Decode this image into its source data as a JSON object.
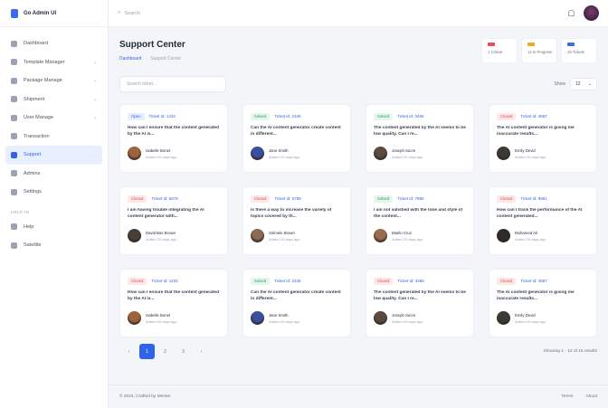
{
  "brand": {
    "name": "Go Admin UI"
  },
  "sidebar": {
    "items": [
      {
        "label": "Dashboard",
        "icon": "home-icon",
        "chevron": false
      },
      {
        "label": "Template Manager",
        "icon": "template-icon",
        "chevron": true
      },
      {
        "label": "Package Manage",
        "icon": "package-icon",
        "chevron": true
      },
      {
        "label": "Shipment",
        "icon": "shipment-icon",
        "chevron": true
      },
      {
        "label": "User Manage",
        "icon": "user-icon",
        "chevron": true
      },
      {
        "label": "Transaction",
        "icon": "transaction-icon",
        "chevron": false
      },
      {
        "label": "Support",
        "icon": "support-icon",
        "chevron": false,
        "active": true
      },
      {
        "label": "Admins",
        "icon": "admin-icon",
        "chevron": false
      },
      {
        "label": "Settings",
        "icon": "gear-icon",
        "chevron": false
      }
    ],
    "section_label": "HELP IN",
    "help_items": [
      {
        "label": "Help",
        "icon": "help-icon"
      },
      {
        "label": "Satellite",
        "icon": "satellite-icon"
      }
    ]
  },
  "topbar": {
    "search_placeholder": "Search"
  },
  "page": {
    "title": "Support Center",
    "breadcrumb": {
      "link": "Dashboard",
      "separator": "·",
      "current": "Support Center"
    }
  },
  "stats": [
    {
      "label": "1 Critical",
      "color": "#ef4b5a"
    },
    {
      "label": "12 In Progress",
      "color": "#f5a524"
    },
    {
      "label": "16 Tickets",
      "color": "#3b6cf0"
    }
  ],
  "filters": {
    "search_placeholder": "Search ticket...",
    "show_label": "Show",
    "show_value": "12"
  },
  "tickets": [
    {
      "status": "Open",
      "status_color": "blue",
      "id": "Ticket Id: 1234",
      "text": "How can I ensure that the content generated by the AI is...",
      "user": "Isabelle Bonet",
      "time": "Added 20 days ago",
      "avatar": "#a0623a"
    },
    {
      "status": "Solved",
      "status_color": "green",
      "id": "Ticket Id: 2345",
      "text": "Can the AI content generator create content in different...",
      "user": "Jane Smith",
      "time": "Added 20 days ago",
      "avatar": "#3a4fa0"
    },
    {
      "status": "Solved",
      "status_color": "green",
      "id": "Ticket Id: 3456",
      "text": "The content generated by the AI seems to be low quality. Can I re...",
      "user": "Joseph Sucre",
      "time": "Added 20 days ago",
      "avatar": "#5b4a3d"
    },
    {
      "status": "Closed",
      "status_color": "red",
      "id": "Ticket Id: 4567",
      "text": "The AI content generator is giving me inaccurate results...",
      "user": "Emily Devid",
      "time": "Added 20 days ago",
      "avatar": "#3d3a33"
    },
    {
      "status": "Closed",
      "status_color": "red",
      "id": "Ticket Id: 5678",
      "text": "I am having trouble integrating the AI content generator with...",
      "user": "David Bas Brown",
      "time": "Added 20 days ago",
      "avatar": "#4a3f36"
    },
    {
      "status": "Closed",
      "status_color": "red",
      "id": "Ticket Id: 6789",
      "text": "Is there a way to increase the variety of topics covered by th...",
      "user": "Sirimele Brown",
      "time": "Added 20 days ago",
      "avatar": "#8a6a52"
    },
    {
      "status": "Solved",
      "status_color": "green",
      "id": "Ticket Id: 7890",
      "text": "I am not satisfied with the tone and style of the content...",
      "user": "Marilo Cruz",
      "time": "Added 20 days ago",
      "avatar": "#9a6c4e"
    },
    {
      "status": "Closed",
      "status_color": "red",
      "id": "Ticket Id: 8901",
      "text": "How can I track the performance of the AI content generated...",
      "user": "Mohamed Ali",
      "time": "Added 20 days ago",
      "avatar": "#2e2b28"
    },
    {
      "status": "Closed",
      "status_color": "red",
      "id": "Ticket Id: 1234",
      "text": "How can I ensure that the content generated by the AI is...",
      "user": "Isabelle Bonet",
      "time": "Added 20 days ago",
      "avatar": "#a0623a"
    },
    {
      "status": "Solved",
      "status_color": "green",
      "id": "Ticket Id: 2345",
      "text": "Can the AI content generator create content in different...",
      "user": "Jane Smith",
      "time": "Added 20 days ago",
      "avatar": "#3a4fa0"
    },
    {
      "status": "Closed",
      "status_color": "red",
      "id": "Ticket Id: 3456",
      "text": "The content generated by the AI seems to be low quality. Can I re...",
      "user": "Joseph Sucre",
      "time": "Added 20 days ago",
      "avatar": "#5b4a3d"
    },
    {
      "status": "Closed",
      "status_color": "red",
      "id": "Ticket Id: 4567",
      "text": "The AI content generator is giving me inaccurate results...",
      "user": "Emily Devid",
      "time": "Added 20 days ago",
      "avatar": "#3d3a33"
    }
  ],
  "pagination": {
    "prev": "‹",
    "pages": [
      "1",
      "2",
      "3"
    ],
    "next": "›",
    "active": "1"
  },
  "showing_text": "Showing 1 - 12 of 16 results",
  "footer": {
    "copyright": "© 2024, Crafted by Menter",
    "links": [
      "Terms",
      "About"
    ]
  }
}
